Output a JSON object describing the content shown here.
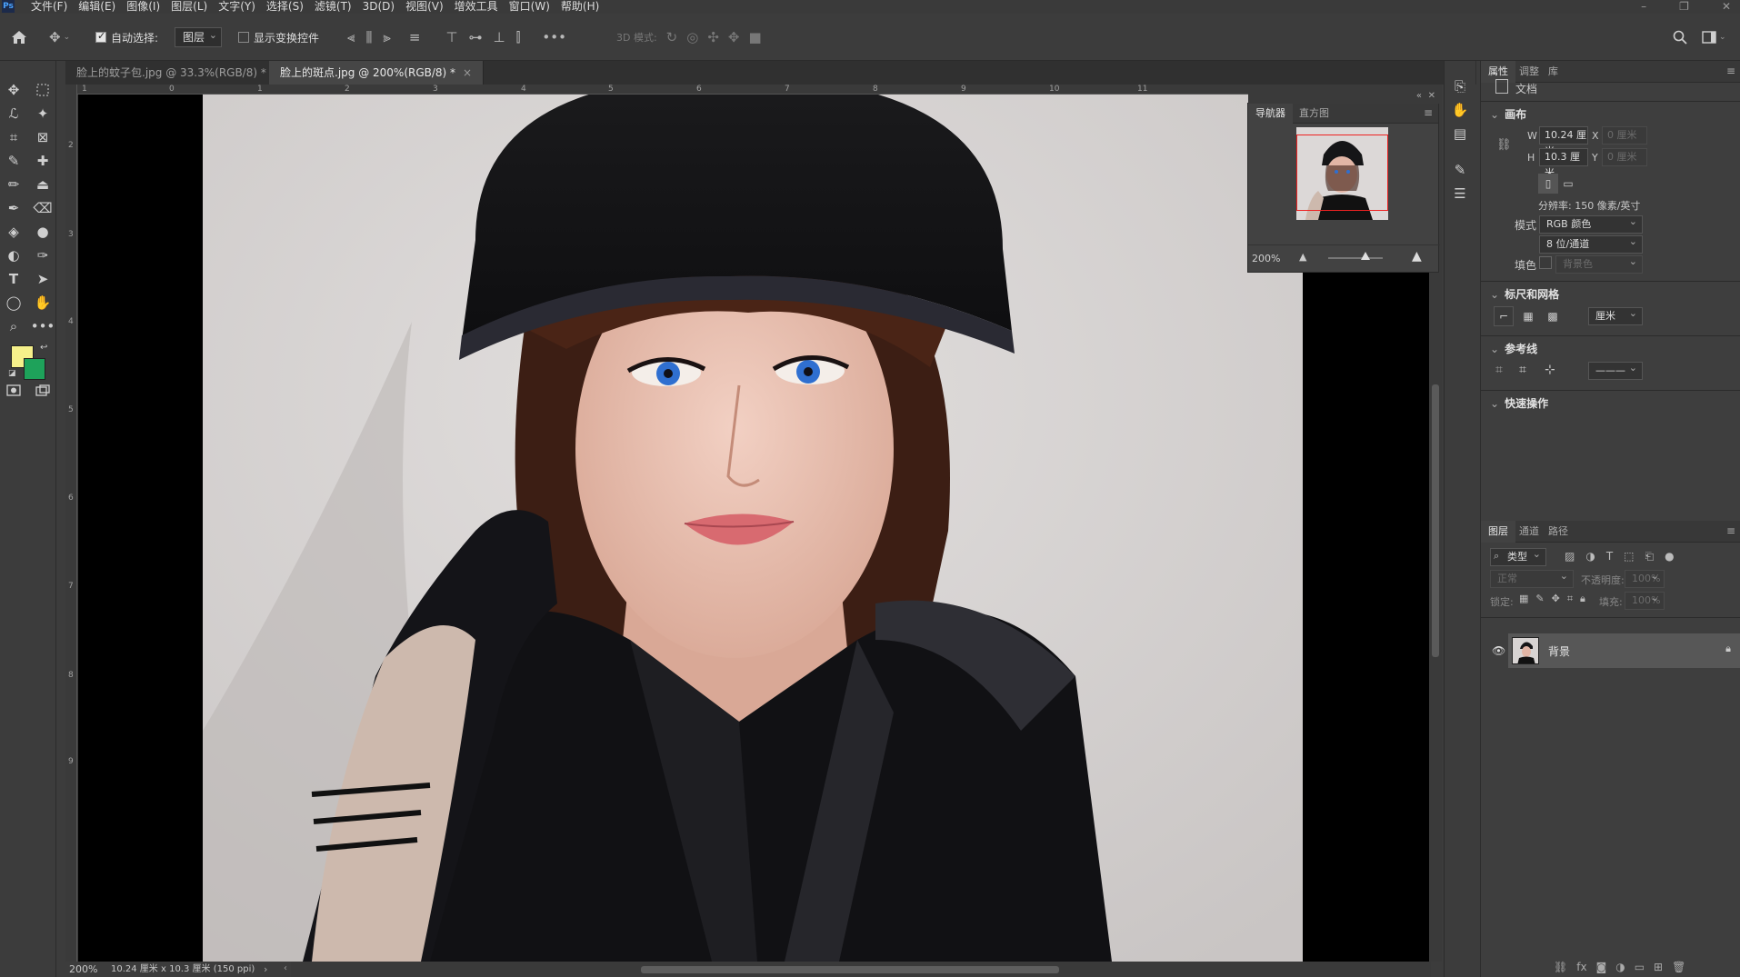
{
  "app": {
    "logo": "Ps"
  },
  "menu": [
    "文件(F)",
    "编辑(E)",
    "图像(I)",
    "图层(L)",
    "文字(Y)",
    "选择(S)",
    "滤镜(T)",
    "3D(D)",
    "视图(V)",
    "增效工具",
    "窗口(W)",
    "帮助(H)"
  ],
  "window_controls": {
    "minimize": "–",
    "restore": "❐",
    "close": "✕"
  },
  "options": {
    "auto_select_label": "自动选择:",
    "auto_select_value": "图层",
    "show_transform_label": "显示变换控件",
    "mode_3d_label": "3D 模式:"
  },
  "tabs": [
    {
      "label": "脸上的蚊子包.jpg @ 33.3%(RGB/8) *",
      "close": "×"
    },
    {
      "label": "脸上的斑点.jpg @ 200%(RGB/8) *",
      "close": "×"
    }
  ],
  "ruler": {
    "top": [
      "1",
      "0",
      "1",
      "2",
      "3",
      "4",
      "5",
      "6",
      "7",
      "8",
      "9",
      "10",
      "11"
    ],
    "left": [
      "2",
      "3",
      "4",
      "5",
      "6",
      "7",
      "8",
      "9"
    ]
  },
  "status": {
    "zoom": "200%",
    "dims": "10.24 厘米 x 10.3 厘米 (150 ppi)",
    "arrow": "›",
    "left_arrow": "‹"
  },
  "navigator": {
    "tab_navigator": "导航器",
    "tab_histogram": "直方图",
    "zoom": "200%",
    "collapse": "«",
    "close": "✕",
    "menu": "≡"
  },
  "colors": {
    "foreground": "#f5f08a",
    "background": "#1ea25a",
    "accent_red": "#e22222"
  },
  "properties": {
    "tabs": [
      "属性",
      "调整",
      "库"
    ],
    "doc_label": "文档",
    "canvas_title": "画布",
    "w_label": "W",
    "w_value": "10.24 厘米",
    "h_label": "H",
    "h_value": "10.3 厘米",
    "x_label": "X",
    "x_value": "0 厘米",
    "y_label": "Y",
    "y_value": "0 厘米",
    "resolution": "分辨率: 150 像素/英寸",
    "mode_label": "模式",
    "mode_value": "RGB 颜色",
    "depth_value": "8 位/通道",
    "fill_label": "填色",
    "fill_value": "背景色",
    "rulers_title": "标尺和网格",
    "ruler_unit": "厘米",
    "guides_title": "参考线",
    "guide_style": "———",
    "quick_title": "快速操作"
  },
  "layers": {
    "tabs": [
      "图层",
      "通道",
      "路径"
    ],
    "filter_placeholder": "类型",
    "blend_mode": "正常",
    "opacity_label": "不透明度:",
    "opacity_value": "100%",
    "lock_label": "锁定:",
    "fill_label": "填充:",
    "fill_value": "100%",
    "items": [
      {
        "name": "背景",
        "visible": true,
        "locked": true
      }
    ]
  }
}
